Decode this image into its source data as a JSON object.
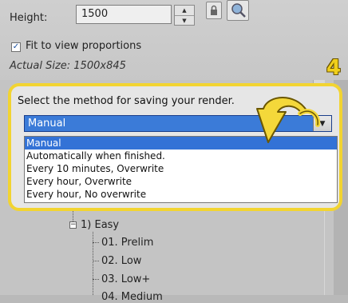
{
  "size": {
    "height_label": "Height:",
    "height_value": "1500",
    "fit_label": "Fit to view proportions",
    "fit_checked": true,
    "actual_size": "Actual Size: 1500x845"
  },
  "save": {
    "step_number": "4",
    "prompt": "Select the method for saving your render.",
    "selected": "Manual",
    "options": [
      "Manual",
      "Automatically when finished.",
      "Every 10 minutes, Overwrite",
      "Every hour, Overwrite",
      "Every hour, No overwrite"
    ]
  },
  "tree": {
    "group_label": "1) Easy",
    "items": [
      "01. Prelim",
      "02. Low",
      "03. Low+",
      "04. Medium"
    ]
  },
  "colors": {
    "callout": "#f2d431",
    "selection": "#3372d6"
  },
  "icons": [
    "lock-icon",
    "zoom-icon",
    "spin-up-icon",
    "spin-down-icon",
    "dropdown-arrow-icon",
    "callout-arrow-icon"
  ]
}
